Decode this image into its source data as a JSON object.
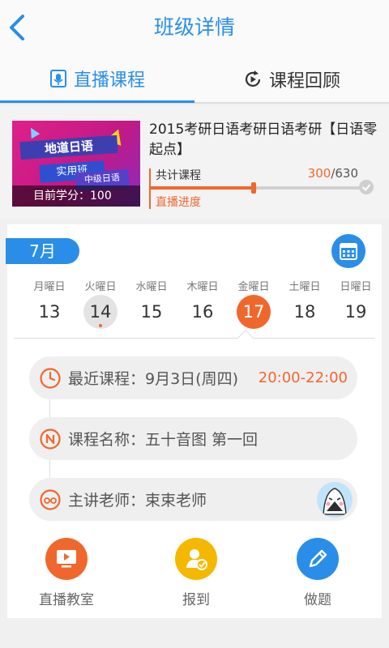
{
  "header": {
    "title": "班级详情"
  },
  "tabs": [
    {
      "label": "直播课程",
      "icon": "live-class-icon",
      "active": true
    },
    {
      "label": "课程回顾",
      "icon": "replay-icon",
      "active": false
    }
  ],
  "course": {
    "thumb_lines": [
      "地道日语",
      "实用班",
      "中级日语"
    ],
    "credit_text": "目前学分：100",
    "title": "2015考研日语考研日语考研【日语零起点】",
    "total_label": "共计课程",
    "done_count": "300",
    "total_count": "/630",
    "progress_fraction": 0.476,
    "progress_label": "直播进度"
  },
  "calendar": {
    "month": "7月",
    "days": [
      {
        "name": "月曜日",
        "date": "13"
      },
      {
        "name": "火曜日",
        "date": "14",
        "today": true
      },
      {
        "name": "水曜日",
        "date": "15"
      },
      {
        "name": "木曜日",
        "date": "16"
      },
      {
        "name": "金曜日",
        "date": "17",
        "selected": true
      },
      {
        "name": "土曜日",
        "date": "18"
      },
      {
        "name": "日曜日",
        "date": "19"
      }
    ]
  },
  "details": {
    "recent": "最近课程：9月3日(周四)",
    "time": "20:00-22:00",
    "course_name": "课程名称：五十音图 第一回",
    "teacher": "主讲老师：束束老师"
  },
  "actions": [
    {
      "label": "直播教室",
      "icon": "live-room-icon",
      "color": "#f0672d"
    },
    {
      "label": "报到",
      "icon": "check-in-icon",
      "color": "#f5b800"
    },
    {
      "label": "做题",
      "icon": "pencil-icon",
      "color": "#2a8ee8"
    }
  ],
  "colors": {
    "accent": "#2a8ee8",
    "orange": "#f0672d",
    "yellow": "#f5b800"
  }
}
